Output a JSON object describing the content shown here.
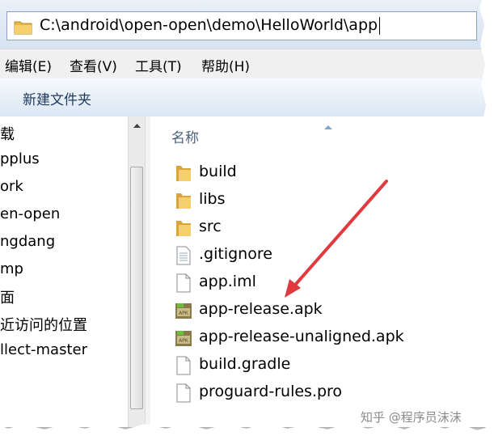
{
  "address_bar": {
    "path": "C:\\android\\open-open\\demo\\HelloWorld\\app"
  },
  "menu": [
    {
      "label": "编辑(E)"
    },
    {
      "label": "查看(V)"
    },
    {
      "label": "工具(T)"
    },
    {
      "label": "帮助(H)"
    }
  ],
  "toolbar": {
    "new_folder_label": "新建文件夹"
  },
  "nav": {
    "items": [
      {
        "label": "载"
      },
      {
        "label": "pplus"
      },
      {
        "label": "ork"
      },
      {
        "label": "en-open"
      },
      {
        "label": "ngdang"
      },
      {
        "label": "mp"
      },
      {
        "label": "面"
      },
      {
        "label": "近访问的位置"
      },
      {
        "label": "llect-master"
      }
    ]
  },
  "content": {
    "column_header": "名称",
    "files": [
      {
        "name": "build",
        "icon": "folder-icon"
      },
      {
        "name": "libs",
        "icon": "folder-icon"
      },
      {
        "name": "src",
        "icon": "folder-icon"
      },
      {
        "name": ".gitignore",
        "icon": "text-file-icon"
      },
      {
        "name": "app.iml",
        "icon": "file-icon"
      },
      {
        "name": "app-release.apk",
        "icon": "apk-file-icon"
      },
      {
        "name": "app-release-unaligned.apk",
        "icon": "apk-file-icon"
      },
      {
        "name": "build.gradle",
        "icon": "file-icon"
      },
      {
        "name": "proguard-rules.pro",
        "icon": "file-icon"
      }
    ]
  },
  "watermark": "知乎 @程序员沫沫",
  "colors": {
    "folder": "#e8b94a",
    "annotation_arrow": "#e0393e",
    "toolbar_text": "#1e395b"
  }
}
